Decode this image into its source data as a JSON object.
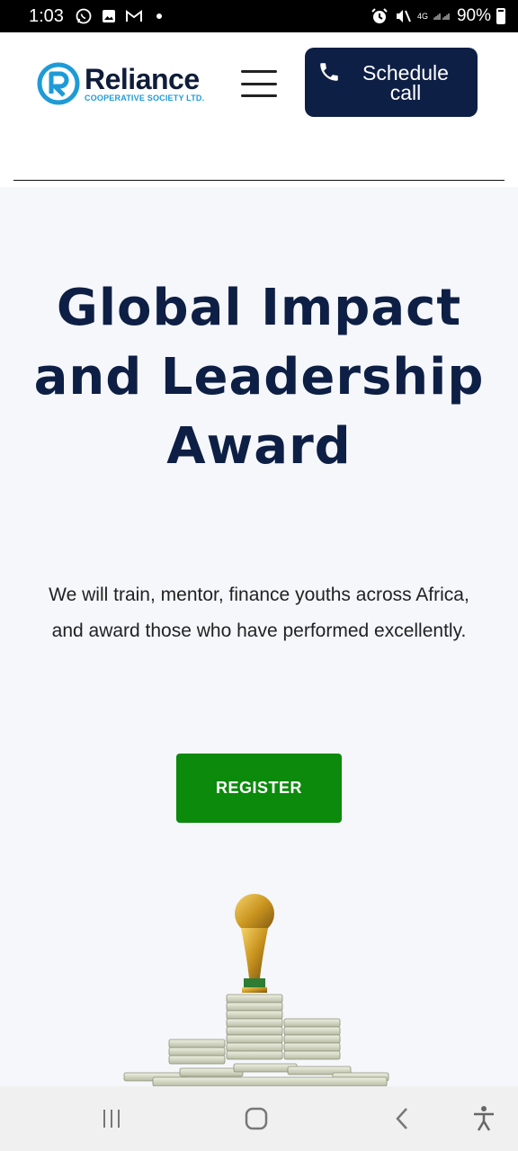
{
  "status_bar": {
    "time": "1:03",
    "network": "4G",
    "battery": "90%",
    "icons": [
      "whatsapp-icon",
      "gallery-icon",
      "gmail-icon",
      "dot-icon",
      "alarm-icon",
      "mute-icon",
      "signal-icon"
    ]
  },
  "header": {
    "logo_name": "Reliance",
    "logo_subtitle": "COOPERATIVE SOCIETY LTD.",
    "menu_icon": "hamburger-menu-icon",
    "schedule_label": "Schedule call",
    "schedule_icon": "phone-icon",
    "brand_color": "#0e1f45",
    "accent_color": "#1e9bd7"
  },
  "hero": {
    "title": "Global Impact and Leadership Award",
    "description": "We will train, mentor, finance youths across Africa, and award those who have performed excellently.",
    "register_label": "REGISTER",
    "register_color": "#0b8a0b",
    "image": "trophy-on-money-stacks"
  },
  "nav_bar": {
    "items": [
      "recent-apps-icon",
      "home-icon",
      "back-icon",
      "accessibility-icon"
    ]
  }
}
